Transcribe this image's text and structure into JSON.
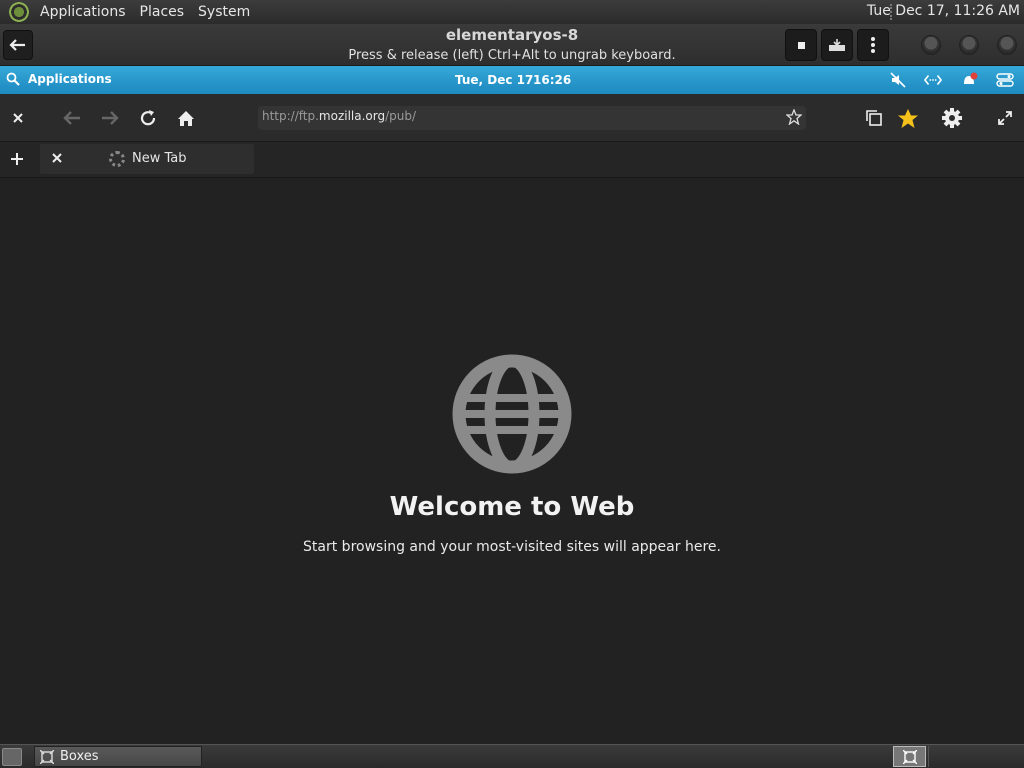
{
  "host_panel": {
    "menus": [
      "Applications",
      "Places",
      "System"
    ],
    "clock": "Tue Dec 17, 11:26 AM"
  },
  "boxes_header": {
    "title": "elementaryos-8",
    "subtitle": "Press & release (left) Ctrl+Alt to ungrab keyboard."
  },
  "guest_panel": {
    "applications_label": "Applications",
    "date": "Tue, Dec 17",
    "time": "16:26",
    "accent": "#1d89c0"
  },
  "browser": {
    "url_prefix": "http://ftp.",
    "url_host": "mozilla.org",
    "url_suffix": "/pub/"
  },
  "tab": {
    "label": "New Tab"
  },
  "content": {
    "title": "Welcome to Web",
    "subtitle": "Start browsing and your most-visited sites will appear here."
  },
  "taskbar": {
    "item_label": "Boxes"
  }
}
